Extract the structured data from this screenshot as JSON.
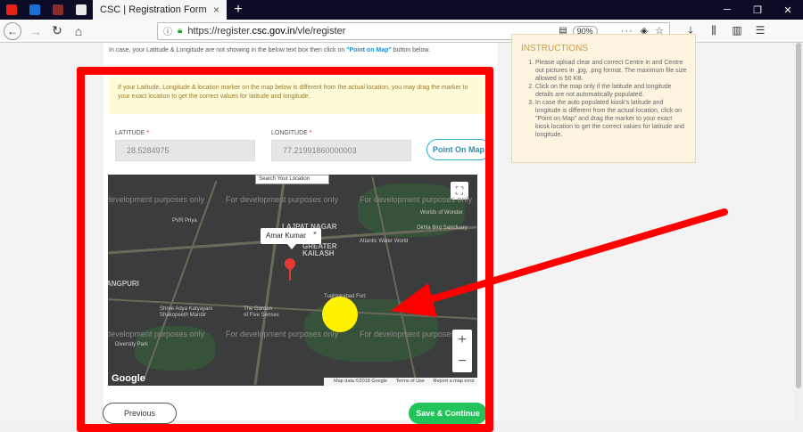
{
  "browser": {
    "tabs": [
      {
        "icon": "youtube-icon",
        "color": "#e62117"
      },
      {
        "icon": "zoho-icon",
        "color": "#1a6fd6"
      },
      {
        "icon": "media-icon",
        "color": "#8a2c2c"
      },
      {
        "icon": "page-icon",
        "color": "#e8e8e8"
      }
    ],
    "active_tab_title": "CSC | Registration Form",
    "active_tab_close": "×",
    "new_tab": "+",
    "url_prefix": "https://register.",
    "url_domain": "csc.gov.in",
    "url_path": "/vle/register",
    "zoom": "90%"
  },
  "page": {
    "note_prefix": "In case, your Latitude & Longitude are not showing in the below text box then click on ",
    "note_link": "\"Point on Map\"",
    "note_suffix": " button below.",
    "warning": "If your Latitude, Longitude & location marker on the map below is different from the actual location, you may drag the marker to your exact location to get the correct values for latitude and longitude.",
    "latitude_label": "LATITUDE",
    "latitude_value": "28.5284975",
    "longitude_label": "LONGITUDE",
    "longitude_value": "77.21991860000003",
    "point_on_map": "Point On Map",
    "required_mark": "*",
    "previous": "Previous",
    "save_continue": "Save & Continue"
  },
  "map": {
    "search_placeholder": "Search Your Location",
    "marker_label": "Amar Kumar",
    "marker_close": "×",
    "dev_watermark": "For development purposes only",
    "dev_watermark_partial": "development purposes only",
    "places": {
      "lajpat_nagar": "LAJPAT NAGAR",
      "greater_kailash": "GREATER\nKAILASH",
      "angpuri": "ANGPURI",
      "pvr_priya": "PVR Priya",
      "tughlakabad": "Tughlakabad Fort",
      "atlantic": "Atlantic Water World",
      "worlds_wonder": "Worlds of Wonder",
      "shree_adya": "Shree Adya Katyayani\nShakopeeth Mandir",
      "garden": "The Garden\nof Five Senses",
      "okhla": "Okhla Bird Sanctuary",
      "diversity": "Diversity Park"
    },
    "zoom_in": "+",
    "zoom_out": "−",
    "google": "Google",
    "map_data": "Map data ©2018 Google",
    "terms": "Terms of Use",
    "report": "Report a map error"
  },
  "instructions": {
    "title": "INSTRUCTIONS",
    "items": [
      "Please upload clear and correct Centre in and Centre out pictures in .jpg, .png format. The maximum file size allowed is 50 KB.",
      "Click on the map only if the latitude and longitude details are not automatically populated.",
      "In case the auto populated kiosk's latitude and longitude is different from the actual location, click on \"Point on Map\" and drag the marker to your exact kiosk location to get the correct values for latitude and longitude."
    ]
  },
  "colors": {
    "annotation_red": "#ff0000",
    "highlight_yellow": "#fff200",
    "save_green": "#21c35a"
  }
}
